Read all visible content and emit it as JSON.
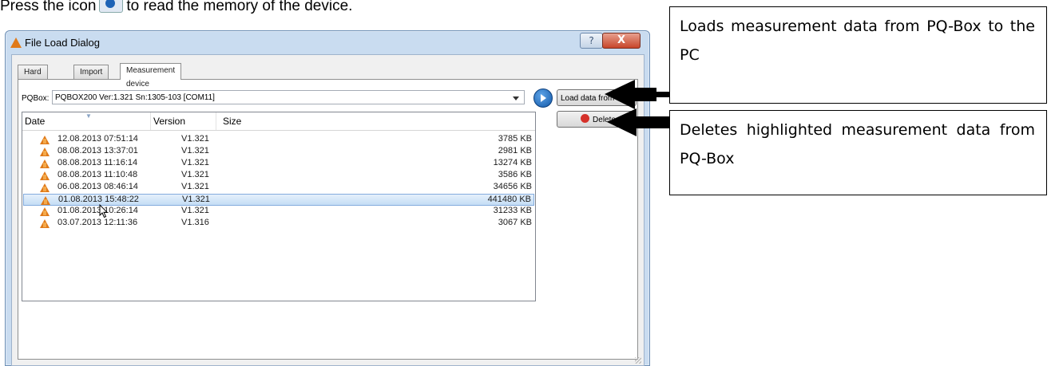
{
  "intro": {
    "before_icon": "Press the icon",
    "after_icon": "to read the memory of the device."
  },
  "window": {
    "title": "File Load Dialog",
    "help_label": "?",
    "close_label": "X"
  },
  "tabs": [
    {
      "label": "Hard disk"
    },
    {
      "label": "Import"
    },
    {
      "label": "Measurement device"
    }
  ],
  "device": {
    "label": "PQBox:",
    "selected": "PQBOX200 Ver:1.321 Sn:1305-103 [COM11]"
  },
  "buttons": {
    "load_label": "Load data from Box",
    "delete_label": "Delete"
  },
  "table": {
    "headers": {
      "date": "Date",
      "version": "Version",
      "size": "Size"
    },
    "rows": [
      {
        "date": "12.08.2013 07:51:14",
        "version": "V1.321",
        "size": "3785 KB"
      },
      {
        "date": "08.08.2013 13:37:01",
        "version": "V1.321",
        "size": "2981 KB"
      },
      {
        "date": "08.08.2013 11:16:14",
        "version": "V1.321",
        "size": "13274 KB"
      },
      {
        "date": "08.08.2013 11:10:48",
        "version": "V1.321",
        "size": "3586 KB"
      },
      {
        "date": "06.08.2013 08:46:14",
        "version": "V1.321",
        "size": "34656 KB"
      },
      {
        "date": "01.08.2013 15:48:22",
        "version": "V1.321",
        "size": "441480 KB",
        "selected": true
      },
      {
        "date": "01.08.2013 10:26:14",
        "version": "V1.321",
        "size": "31233 KB"
      },
      {
        "date": "03.07.2013 12:11:36",
        "version": "V1.316",
        "size": "3067 KB"
      }
    ]
  },
  "callouts": {
    "load": "Loads measurement data from PQ-Box to the PC",
    "delete": "Deletes highlighted measurement data from PQ-Box"
  },
  "colors": {
    "accent": "#1e63b6",
    "selection": "#c4ddf5",
    "app_icon": "#e07a1a",
    "delete_icon": "#d5312a"
  },
  "icons": {
    "read_device": "play-circle-icon",
    "app": "triangle-logo-icon",
    "delete": "delete-icon"
  }
}
